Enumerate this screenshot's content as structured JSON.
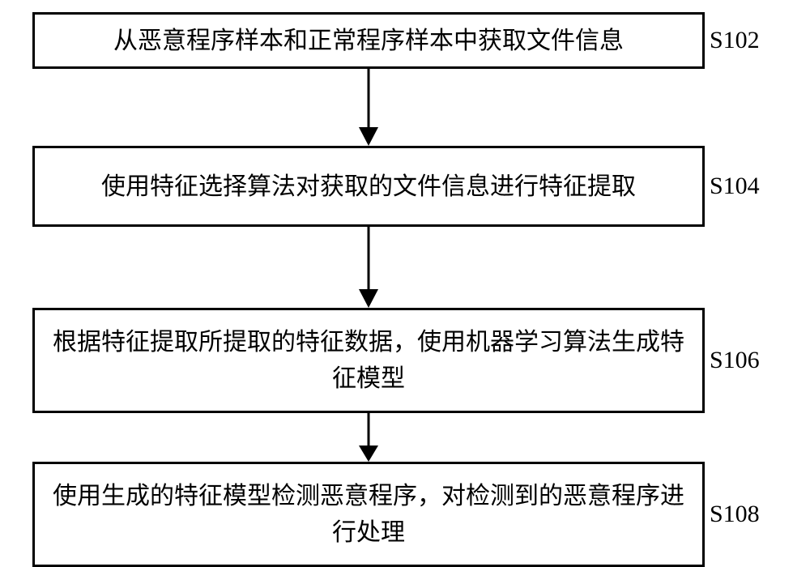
{
  "steps": {
    "s1": {
      "label": "S102",
      "text": "从恶意程序样本和正常程序样本中获取文件信息"
    },
    "s2": {
      "label": "S104",
      "text": "使用特征选择算法对获取的文件信息进行特征提取"
    },
    "s3": {
      "label": "S106",
      "text": "根据特征提取所提取的特征数据，使用机器学习算法生成特征模型"
    },
    "s4": {
      "label": "S108",
      "text": "使用生成的特征模型检测恶意程序，对检测到的恶意程序进行处理"
    }
  }
}
